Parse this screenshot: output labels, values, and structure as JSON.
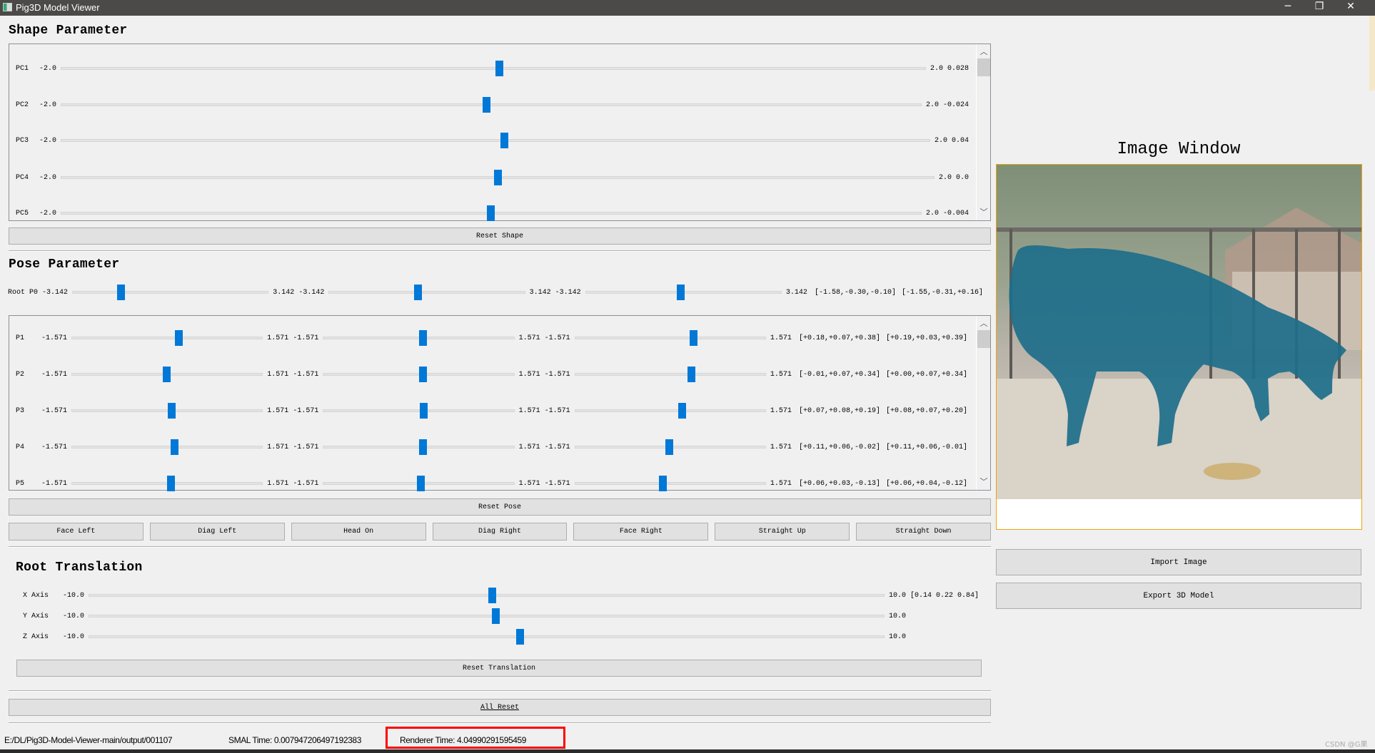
{
  "window": {
    "title": "Pig3D Model Viewer",
    "minimize": "─",
    "restore": "❐",
    "close": "✕"
  },
  "shape": {
    "title": "Shape Parameter",
    "rows": [
      {
        "label": "PC1",
        "min": "-2.0",
        "max": "2.0",
        "value": "0.028"
      },
      {
        "label": "PC2",
        "min": "-2.0",
        "max": "2.0",
        "value": "-0.024"
      },
      {
        "label": "PC3",
        "min": "-2.0",
        "max": "2.0",
        "value": "0.04"
      },
      {
        "label": "PC4",
        "min": "-2.0",
        "max": "2.0",
        "value": "0.0"
      },
      {
        "label": "PC5",
        "min": "-2.0",
        "max": "2.0",
        "value": "-0.004"
      }
    ],
    "reset_label": "Reset Shape"
  },
  "pose": {
    "title": "Pose Parameter",
    "root": {
      "label": "Root P0",
      "min": "-3.142",
      "max": "3.142",
      "values": [
        -1.58,
        -0.3,
        -0.1
      ],
      "vec1": "[-1.58,-0.30,-0.10]",
      "vec2": "[-1.55,-0.31,+0.16]"
    },
    "rows": [
      {
        "label": "P1",
        "min": "-1.571",
        "max": "1.571",
        "values": [
          0.18,
          0.07,
          0.38
        ],
        "vec1": "[+0.18,+0.07,+0.38]",
        "vec2": "[+0.19,+0.03,+0.39]"
      },
      {
        "label": "P2",
        "min": "-1.571",
        "max": "1.571",
        "values": [
          -0.01,
          0.07,
          0.34
        ],
        "vec1": "[-0.01,+0.07,+0.34]",
        "vec2": "[+0.00,+0.07,+0.34]"
      },
      {
        "label": "P3",
        "min": "-1.571",
        "max": "1.571",
        "values": [
          0.07,
          0.08,
          0.19
        ],
        "vec1": "[+0.07,+0.08,+0.19]",
        "vec2": "[+0.08,+0.07,+0.20]"
      },
      {
        "label": "P4",
        "min": "-1.571",
        "max": "1.571",
        "values": [
          0.11,
          0.06,
          -0.02
        ],
        "vec1": "[+0.11,+0.06,-0.02]",
        "vec2": "[+0.11,+0.06,-0.01]"
      },
      {
        "label": "P5",
        "min": "-1.571",
        "max": "1.571",
        "values": [
          0.06,
          0.03,
          -0.13
        ],
        "vec1": "[+0.06,+0.03,-0.13]",
        "vec2": "[+0.06,+0.04,-0.12]"
      }
    ],
    "reset_label": "Reset Pose",
    "presets": [
      "Face Left",
      "Diag Left",
      "Head On",
      "Diag Right",
      "Face Right",
      "Straight Up",
      "Straight Down"
    ]
  },
  "translation": {
    "title": "Root Translation",
    "rows": [
      {
        "label": "X Axis",
        "min": "-10.0",
        "max": "10.0",
        "value": 0.14
      },
      {
        "label": "Y Axis",
        "min": "-10.0",
        "max": "10.0",
        "value": 0.22
      },
      {
        "label": "Z Axis",
        "min": "-10.0",
        "max": "10.0",
        "value": 0.84
      }
    ],
    "vector": "[0.14 0.22 0.84]",
    "reset_label": "Reset Translation"
  },
  "all_reset_label": "All Reset",
  "image_panel": {
    "title": "Image Window",
    "import_label": "Import Image",
    "export_label": "Export 3D Model",
    "border_color": "#f0a30a",
    "mesh_color": "#1e6e8a"
  },
  "status": {
    "path": "E:/DL/Pig3D-Model-Viewer-main/output/001107",
    "smal_time": "SMAL Time: 0.007947206497192383",
    "renderer_time": "Renderer Time: 4.04990291595459",
    "highlight_color": "#ff0000"
  },
  "watermark": "CSDN @G果",
  "colors": {
    "slider_handle": "#0078d7"
  }
}
